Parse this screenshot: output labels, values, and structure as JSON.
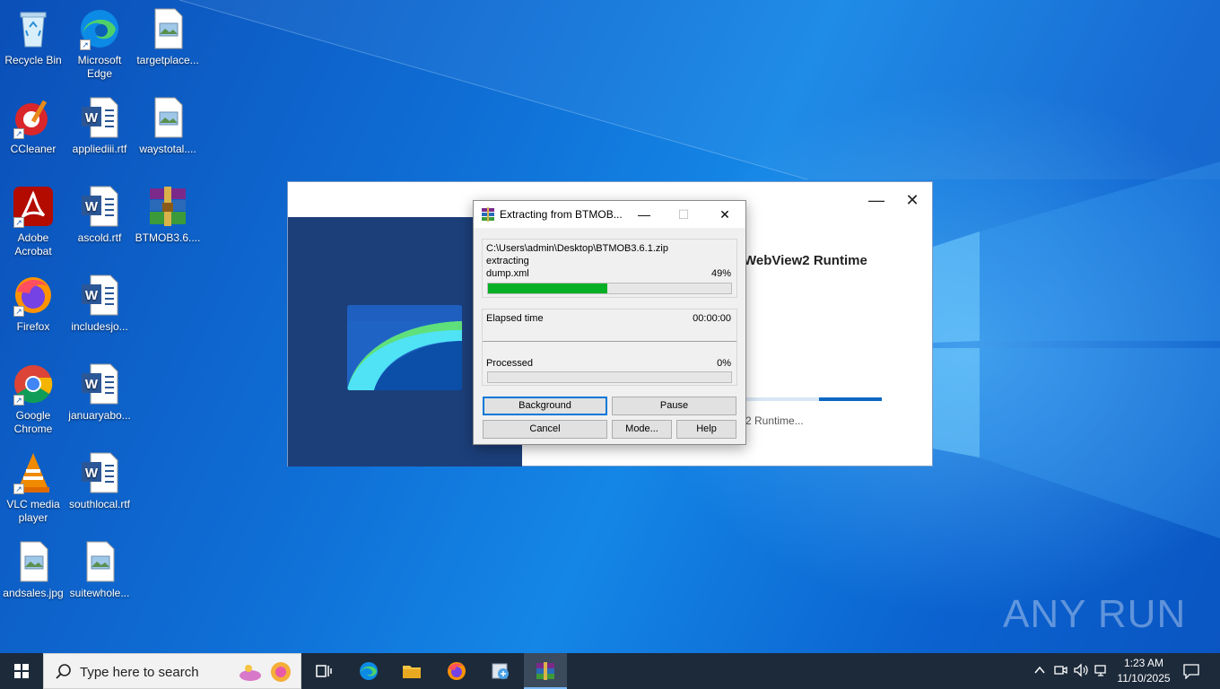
{
  "desktop": {
    "icons": [
      {
        "label": "Recycle Bin",
        "icon": "recycle-bin-icon"
      },
      {
        "label": "Microsoft Edge",
        "icon": "edge-icon"
      },
      {
        "label": "targetplace...",
        "icon": "image-file-icon"
      },
      {
        "label": "CCleaner",
        "icon": "ccleaner-icon"
      },
      {
        "label": "appliediii.rtf",
        "icon": "word-doc-icon"
      },
      {
        "label": "waystotal....",
        "icon": "image-file-icon"
      },
      {
        "label": "Adobe Acrobat",
        "icon": "acrobat-icon"
      },
      {
        "label": "ascold.rtf",
        "icon": "word-doc-icon"
      },
      {
        "label": "BTMOB3.6....",
        "icon": "winrar-archive-icon"
      },
      {
        "label": "Firefox",
        "icon": "firefox-icon"
      },
      {
        "label": "includesjo...",
        "icon": "word-doc-icon"
      },
      {
        "label": "Google Chrome",
        "icon": "chrome-icon"
      },
      {
        "label": "januaryabo...",
        "icon": "word-doc-icon"
      },
      {
        "label": "VLC media player",
        "icon": "vlc-icon"
      },
      {
        "label": "southlocal.rtf",
        "icon": "word-doc-icon"
      },
      {
        "label": "andsales.jpg",
        "icon": "image-file-icon"
      },
      {
        "label": "suitewhole...",
        "icon": "image-file-icon"
      }
    ]
  },
  "background_window": {
    "heading": "WebView2 Runtime",
    "subtext": "2 Runtime...",
    "minimize_glyph": "—",
    "close_glyph": "✕"
  },
  "dialog": {
    "title": "Extracting from BTMOB...",
    "archive_path": "C:\\Users\\admin\\Desktop\\BTMOB3.6.1.zip",
    "action": "extracting",
    "current_file": "dump.xml",
    "file_percent_label": "49%",
    "file_progress": 0.49,
    "elapsed_label": "Elapsed time",
    "elapsed_value": "00:00:00",
    "processed_label": "Processed",
    "processed_percent_label": "0%",
    "processed_progress": 0.0,
    "buttons": {
      "background": "Background",
      "pause": "Pause",
      "cancel": "Cancel",
      "mode": "Mode...",
      "help": "Help"
    },
    "minimize_glyph": "—",
    "maximize_glyph": "☐",
    "close_glyph": "✕"
  },
  "taskbar": {
    "search_placeholder": "Type here to search",
    "apps": [
      "task-view-icon",
      "edge-icon",
      "file-explorer-icon",
      "firefox-icon",
      "installer-icon",
      "winrar-icon"
    ],
    "active_app": "winrar-icon",
    "clock_time": "1:23 AM",
    "clock_date": "11/10/2025"
  },
  "watermark": "ANY RUN"
}
